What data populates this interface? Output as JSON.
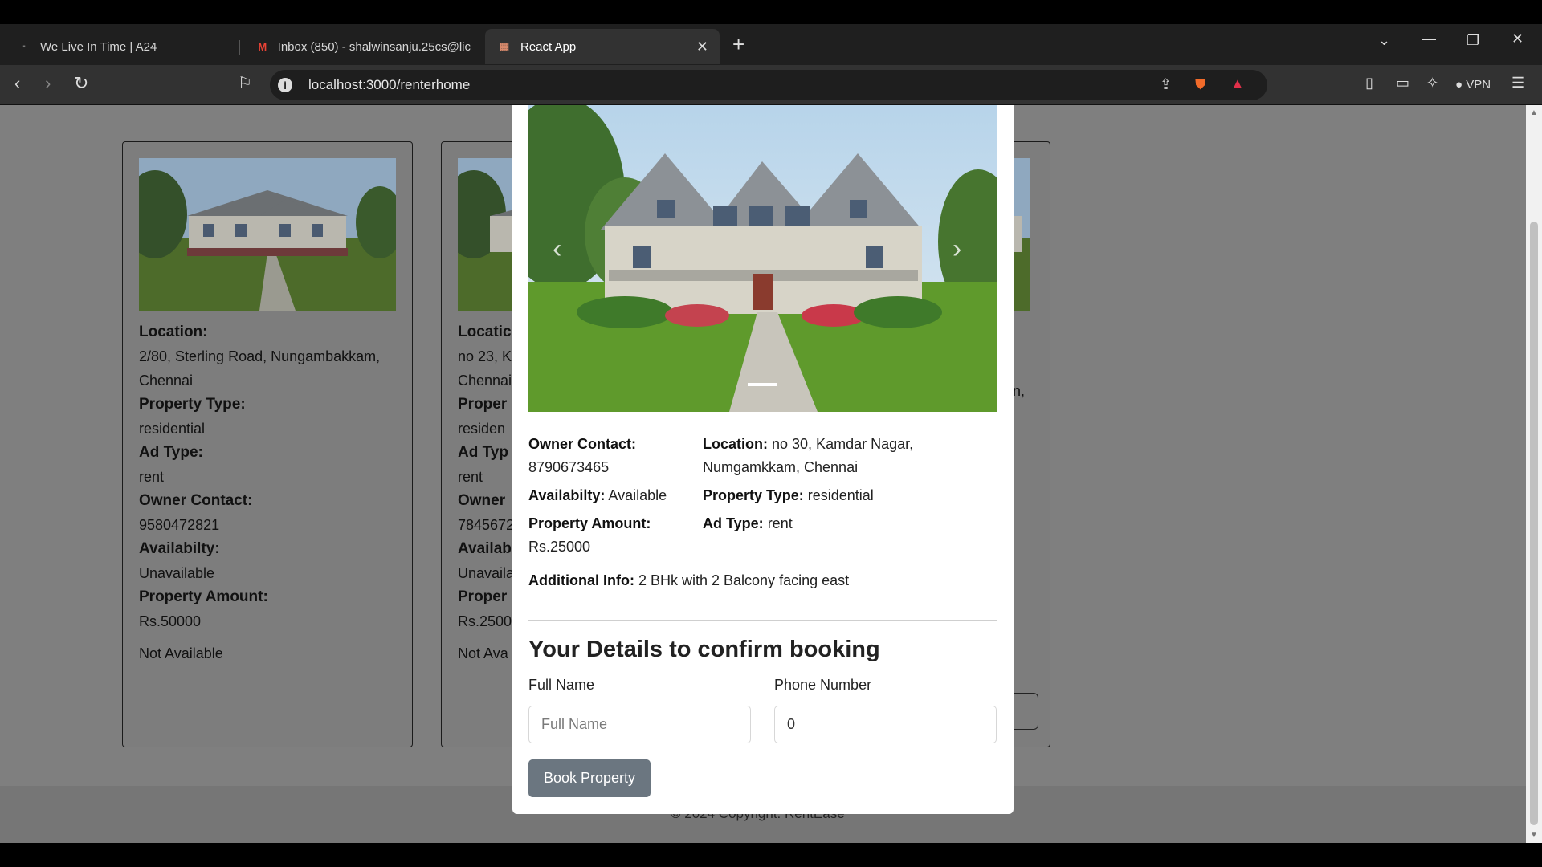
{
  "browser": {
    "tabs": [
      {
        "title": "We Live In Time | A24",
        "icon": "a24-icon"
      },
      {
        "title": "Inbox (850) - shalwinsanju.25cs@lic",
        "icon": "gmail-icon"
      },
      {
        "title": "React App",
        "icon": "react-app-icon",
        "active": true
      }
    ],
    "url": "localhost:3000/renterhome",
    "vpn_label": "VPN"
  },
  "cards": [
    {
      "location_label": "Location:",
      "location": "2/80, Sterling Road, Nungambakkam, Chennai",
      "type_label": "Property Type:",
      "type": "residential",
      "ad_label": "Ad Type:",
      "ad": "rent",
      "owner_label": "Owner Contact:",
      "owner": "9580472821",
      "avail_label": "Availabilty:",
      "avail": "Unavailable",
      "amount_label": "Property Amount:",
      "amount": "Rs.50000",
      "status": "Not Available"
    },
    {
      "location_label": "Locatic",
      "location": "no 23, K Chennai",
      "type_label": "Proper",
      "type": "residen",
      "ad_label": "Ad Typ",
      "ad": "rent",
      "owner_label": "Owner",
      "owner": "7845672",
      "avail_label": "Availab",
      "avail": "Unavaila",
      "amount_label": "Proper",
      "amount": "Rs.2500",
      "status": "Not Ava"
    },
    {
      "location_partial": "n,"
    }
  ],
  "footer": {
    "text": "© 2024 Copyright: RentEase"
  },
  "modal": {
    "owner_label": "Owner Contact:",
    "owner": "8790673465",
    "avail_label": "Availabilty:",
    "avail": "Available",
    "amount_label": "Property Amount:",
    "amount": "Rs.25000",
    "location_label": "Location:",
    "location": "no 30, Kamdar Nagar, Numgamkkam, Chennai",
    "type_label": "Property Type:",
    "type": "residential",
    "ad_label": "Ad Type:",
    "ad": "rent",
    "additional_label": "Additional Info:",
    "additional": "2 BHk with 2 Balcony facing east",
    "form_title": "Your Details to confirm booking",
    "fullname_label": "Full Name",
    "fullname_placeholder": "Full Name",
    "phone_label": "Phone Number",
    "phone_value": "0",
    "book_button": "Book Property"
  }
}
